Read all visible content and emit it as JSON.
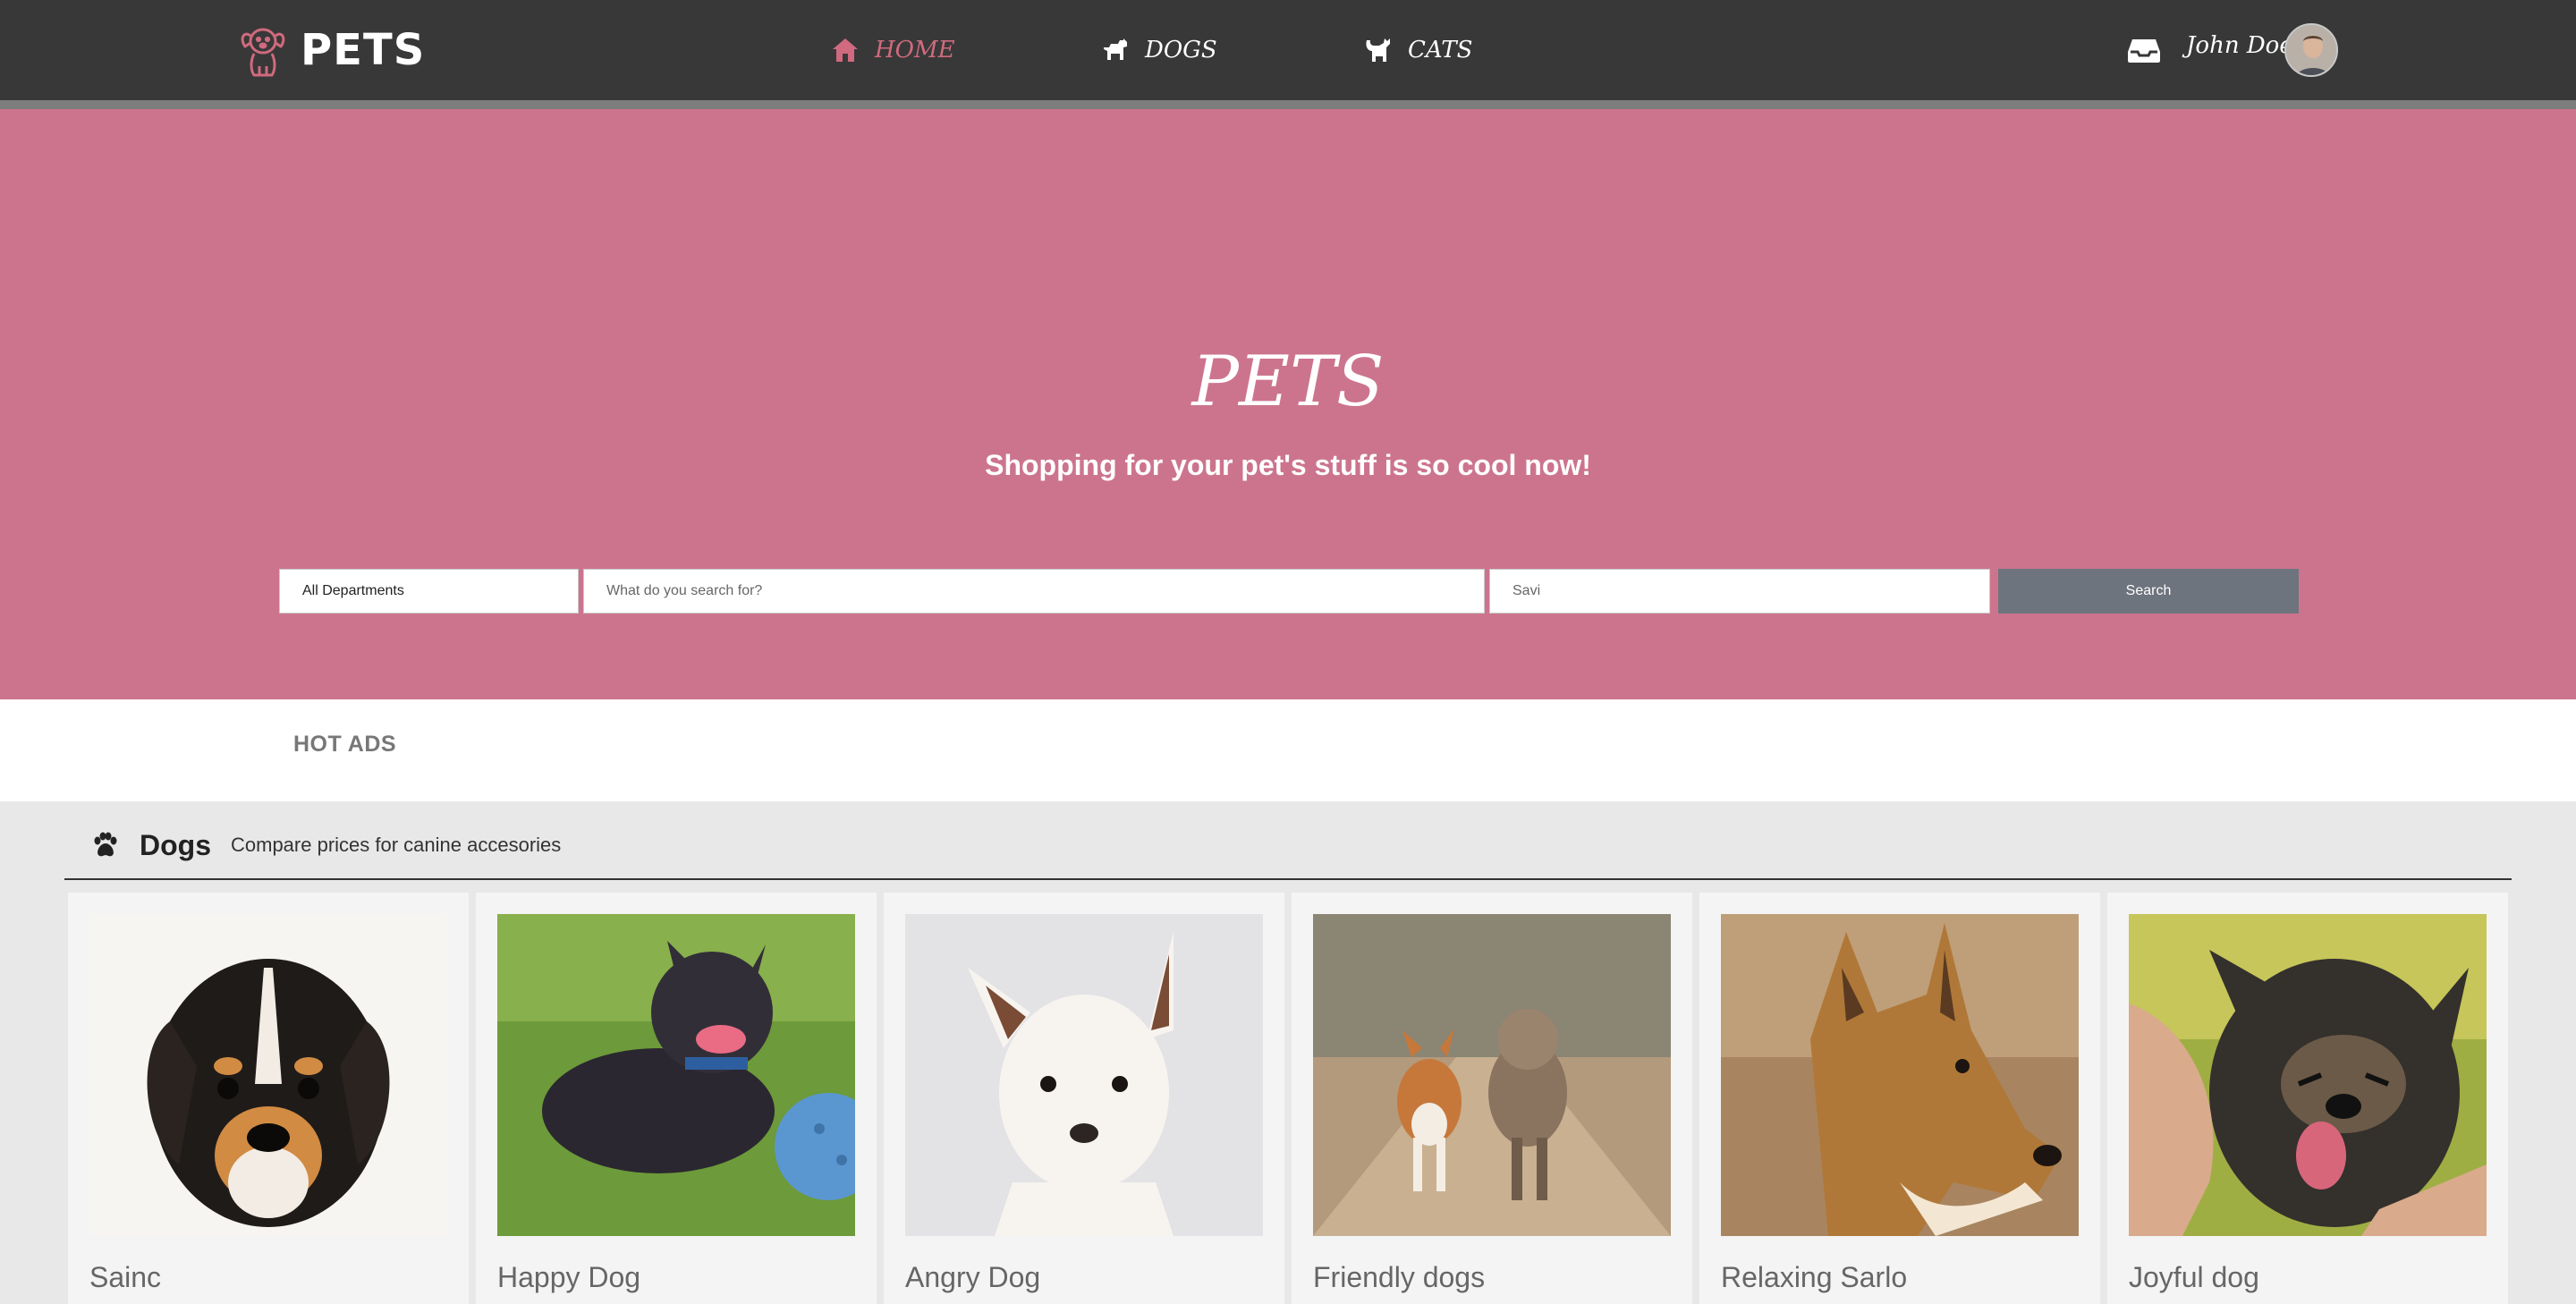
{
  "brand": {
    "name": "PETS",
    "logo_icon": "dog-logo-icon"
  },
  "nav": [
    {
      "label": "HOME",
      "icon": "home-icon",
      "active": true
    },
    {
      "label": "DOGS",
      "icon": "dog-icon",
      "active": false
    },
    {
      "label": "CATS",
      "icon": "cat-icon",
      "active": false
    }
  ],
  "user": {
    "name": "John Doe",
    "inbox_icon": "inbox-icon"
  },
  "hero": {
    "title": "PETS",
    "subtitle": "Shopping for your pet's stuff is so cool now!"
  },
  "search": {
    "department": "All Departments",
    "query_placeholder": "What do you search for?",
    "location_value": "Savi",
    "button_label": "Search"
  },
  "hot_ads": {
    "label": "HOT ADS"
  },
  "dogs_section": {
    "title": "Dogs",
    "subtitle": "Compare prices for canine accesories",
    "icon": "paw-icon",
    "cards": [
      {
        "title": "Sainc"
      },
      {
        "title": "Happy Dog"
      },
      {
        "title": "Angry Dog"
      },
      {
        "title": "Friendly dogs"
      },
      {
        "title": "Relaxing Sarlo"
      },
      {
        "title": "Joyful dog"
      }
    ]
  },
  "colors": {
    "navbar": "#383838",
    "accent": "#d06a7e",
    "hero": "#cc748e",
    "search_button": "#6e747d"
  }
}
